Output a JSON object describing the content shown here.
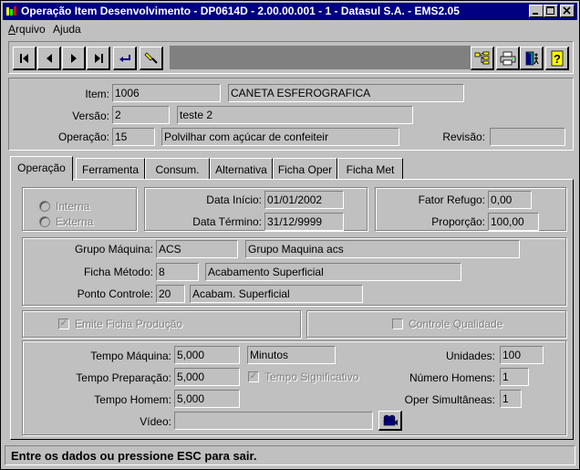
{
  "window": {
    "title": "Operação Item Desenvolvimento - DP0614D - 2.00.00.001 - 1 - Datasul S.A.  - EMS2.05"
  },
  "menu": [
    {
      "label": "Arquivo",
      "mnemonic": "A",
      "rest": "rquivo"
    },
    {
      "label": "Ajuda",
      "mnemonic": "j",
      "pre": "A",
      "rest": "uda"
    }
  ],
  "toolbar": {
    "icons": [
      "first-icon",
      "previous-icon",
      "next-icon",
      "last-icon",
      "goto-icon",
      "search-icon",
      "zoom-tree-icon",
      "print-icon",
      "exit-icon",
      "help-icon"
    ]
  },
  "header": {
    "item_label": "Item:",
    "item_code": "1006",
    "item_desc": "CANETA ESFEROGRAFICA",
    "versao_label": "Versão:",
    "versao": "2",
    "versao_desc": "teste 2",
    "operacao_label": "Operação:",
    "operacao": "15",
    "operacao_desc": "Polvilhar com açúcar de confeiteir",
    "revisao_label": "Revisão:",
    "revisao": ""
  },
  "tabs": [
    {
      "label": "Operação",
      "active": true
    },
    {
      "label": "Ferramenta",
      "active": false
    },
    {
      "label": "Consum.",
      "active": false
    },
    {
      "label": "Alternativa",
      "active": false
    },
    {
      "label": "Ficha Oper",
      "active": false
    },
    {
      "label": "Ficha Met",
      "active": false
    }
  ],
  "operacao_tab": {
    "interna_label": "Interna",
    "externa_label": "Externa",
    "data_inicio_label": "Data Início:",
    "data_inicio": "01/01/2002",
    "data_termino_label": "Data Término:",
    "data_termino": "31/12/9999",
    "fator_refugo_label": "Fator Refugo:",
    "fator_refugo": "0,00",
    "proporcao_label": "Proporção:",
    "proporcao": "100,00",
    "grupo_maquina_label": "Grupo Máquina:",
    "grupo_maquina": "ACS",
    "grupo_maquina_desc": "Grupo Maquina acs",
    "ficha_metodo_label": "Ficha Método:",
    "ficha_metodo": "8",
    "ficha_metodo_desc": "Acabamento Superficial",
    "ponto_controle_label": "Ponto Controle:",
    "ponto_controle": "20",
    "ponto_controle_desc": "Acabam. Superficial",
    "emite_ficha_label": "Emite Ficha Produção",
    "emite_ficha_checked": true,
    "controle_qualidade_label": "Controle Qualidade",
    "controle_qualidade_checked": false,
    "tempo_maquina_label": "Tempo Máquina:",
    "tempo_maquina": "5,000",
    "unidade_tempo": "Minutos",
    "tempo_preparacao_label": "Tempo Preparação:",
    "tempo_preparacao": "5,000",
    "tempo_significativo_label": "Tempo Significativo",
    "tempo_significativo_checked": true,
    "tempo_homem_label": "Tempo Homem:",
    "tempo_homem": "5,000",
    "video_label": "Vídeo:",
    "video": "",
    "unidades_label": "Unidades:",
    "unidades": "100",
    "numero_homens_label": "Número Homens:",
    "numero_homens": "1",
    "oper_simultaneas_label": "Oper Simultâneas:",
    "oper_simultaneas": "1"
  },
  "status": {
    "message": "Entre os dados ou pressione ESC para sair."
  }
}
